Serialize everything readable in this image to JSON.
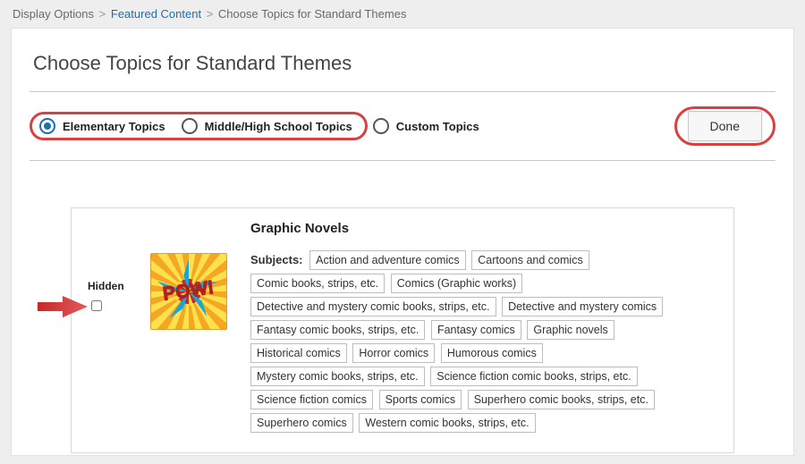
{
  "breadcrumb": {
    "level1": "Display Options",
    "level2": "Featured Content",
    "level3": "Choose Topics for Standard Themes"
  },
  "page": {
    "title": "Choose Topics for Standard Themes"
  },
  "tabs": {
    "elementary": "Elementary Topics",
    "middleHigh": "Middle/High School Topics",
    "custom": "Custom Topics"
  },
  "buttons": {
    "done": "Done"
  },
  "card": {
    "hidden_label": "Hidden",
    "thumb_text": "POW!",
    "category": "Graphic Novels",
    "subjects_label": "Subjects:",
    "subjects": [
      "Action and adventure comics",
      "Cartoons and comics",
      "Comic books, strips, etc.",
      "Comics (Graphic works)",
      "Detective and mystery comic books, strips, etc.",
      "Detective and mystery comics",
      "Fantasy comic books, strips, etc.",
      "Fantasy comics",
      "Graphic novels",
      "Historical comics",
      "Horror comics",
      "Humorous comics",
      "Mystery comic books, strips, etc.",
      "Science fiction comic books, strips, etc.",
      "Science fiction comics",
      "Sports comics",
      "Superhero comic books, strips, etc.",
      "Superhero comics",
      "Western comic books, strips, etc."
    ]
  }
}
